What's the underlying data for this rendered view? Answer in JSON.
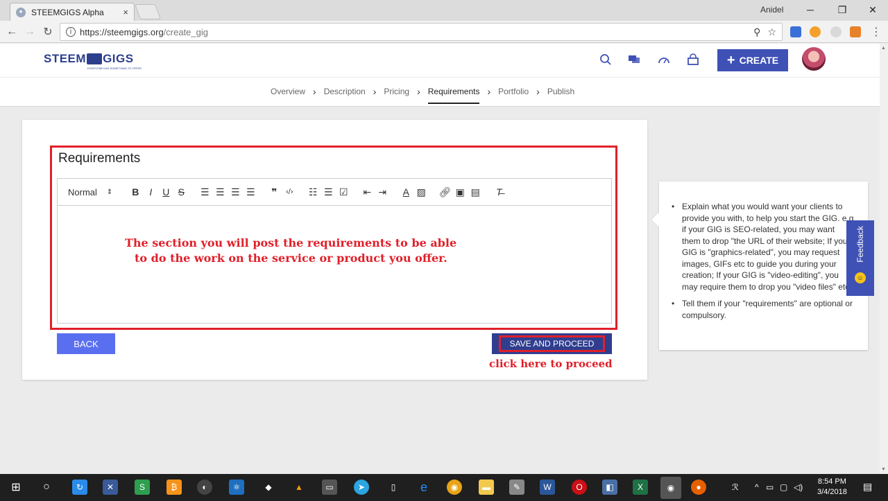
{
  "browser": {
    "tab_title": "STEEMGIGS Alpha",
    "tab_close": "×",
    "user_name": "Anidel",
    "url_host": "https://steemgigs.org",
    "url_path": "/create_gig"
  },
  "site": {
    "logo_left": "STEEM",
    "logo_right": "GIGS",
    "logo_tagline": "EVERYONE HAS SOMETHING TO OFFER",
    "create_label": "CREATE",
    "create_plus": "+"
  },
  "steps": [
    {
      "label": "Overview",
      "active": false
    },
    {
      "label": "Description",
      "active": false
    },
    {
      "label": "Pricing",
      "active": false
    },
    {
      "label": "Requirements",
      "active": true
    },
    {
      "label": "Portfolio",
      "active": false
    },
    {
      "label": "Publish",
      "active": false
    }
  ],
  "form": {
    "title": "Requirements",
    "format_select": "Normal",
    "back_label": "BACK",
    "save_label": "SAVE AND PROCEED"
  },
  "annotations": {
    "main_line1": "The section you will post the requirements to be able",
    "main_line2": "to do the work on the service or product you offer.",
    "proceed": "click here to proceed"
  },
  "tips": {
    "tip1": "Explain what you would want your clients to provide you with, to help you start the GIG. e.g if your GIG is SEO-related, you may want them to drop \"the URL of their website; If your GIG is \"graphics-related\", you may request images, GIFs etc to guide you during your creation; If your GIG is \"video-editing\", you may require them to drop you \"video files\" etc.",
    "tip2": "Tell them if your \"requirements\" are optional or compulsory."
  },
  "feedback_label": "Feedback",
  "taskbar": {
    "time": "8:54 PM",
    "date": "3/4/2018"
  },
  "colors": {
    "brand": "#3f51b5",
    "annotation_red": "#e0202a",
    "save_button": "#2f3e8f",
    "back_button": "#5a6ff0"
  }
}
